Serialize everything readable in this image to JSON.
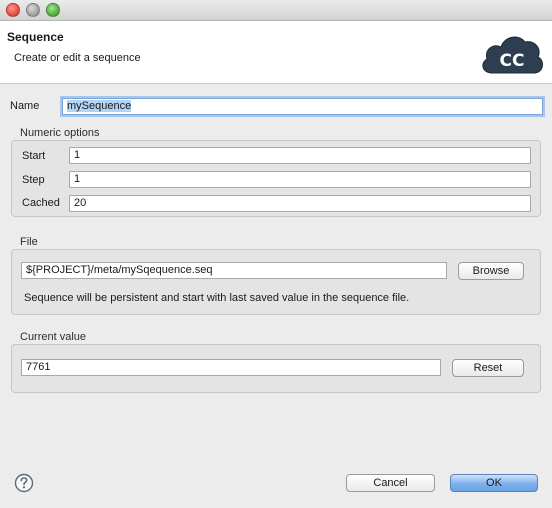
{
  "dialog": {
    "title": "Sequence",
    "subtitle": "Create or edit a sequence",
    "logo_text": "CC"
  },
  "name_field": {
    "label": "Name",
    "value": "mySequence"
  },
  "numeric_options": {
    "title": "Numeric options",
    "start": {
      "label": "Start",
      "value": "1"
    },
    "step": {
      "label": "Step",
      "value": "1"
    },
    "cached": {
      "label": "Cached",
      "value": "20"
    }
  },
  "file": {
    "title": "File",
    "path": "${PROJECT}/meta/mySqequence.seq",
    "browse_label": "Browse",
    "note": "Sequence will be persistent and start with last saved value in the sequence file."
  },
  "current_value": {
    "title": "Current value",
    "value": "7761",
    "reset_label": "Reset"
  },
  "footer": {
    "cancel_label": "Cancel",
    "ok_label": "OK"
  },
  "colors": {
    "primary_button": "#7fb1ec",
    "logo": "#2c3e50",
    "focus_ring": "#a9c6ea"
  },
  "icons": [
    "close-button-icon",
    "minimize-button-icon",
    "zoom-button-icon",
    "cc-cloud-logo",
    "help-icon"
  ]
}
